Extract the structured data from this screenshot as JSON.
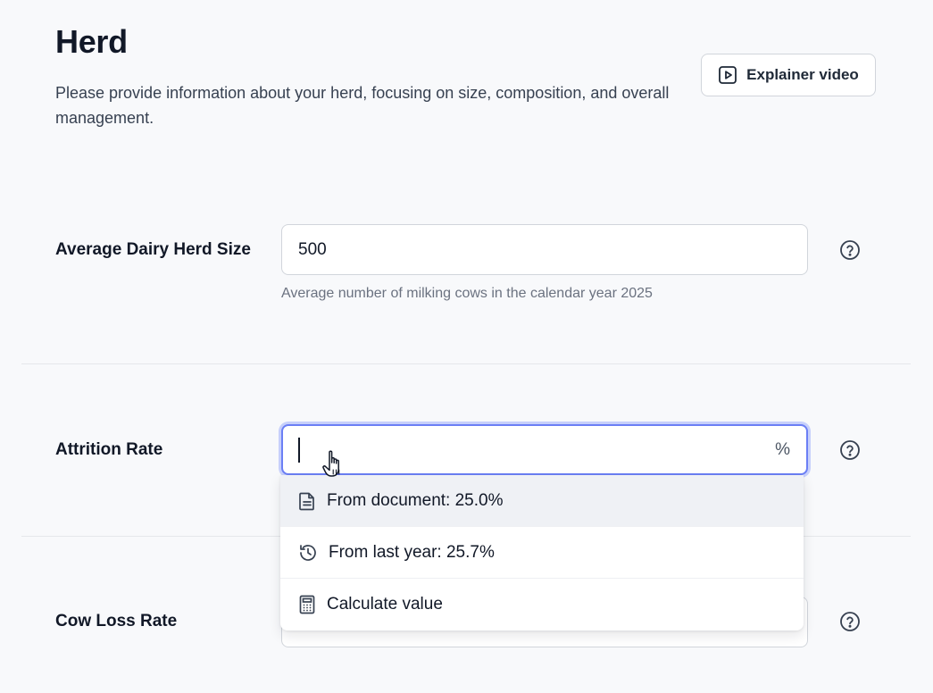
{
  "header": {
    "title": "Herd",
    "description": "Please provide information about your herd, focusing on size, composition, and overall management.",
    "explainer_label": "Explainer video"
  },
  "fields": {
    "herd_size": {
      "label": "Average Dairy Herd Size",
      "value": "500",
      "help": "Average number of milking cows in the calendar year 2025"
    },
    "attrition": {
      "label": "Attrition Rate",
      "value": "",
      "suffix": "%"
    },
    "cow_loss": {
      "label": "Cow Loss Rate",
      "value": ""
    }
  },
  "dropdown": {
    "options": [
      {
        "label": "From document: 25.0%",
        "icon": "document-icon"
      },
      {
        "label": "From last year: 25.7%",
        "icon": "history-icon"
      },
      {
        "label": "Calculate value",
        "icon": "calculator-icon"
      }
    ]
  },
  "colors": {
    "focus_ring": "#6b7ff5",
    "highlight": "#eff1f5",
    "background": "#f8f9fb"
  }
}
